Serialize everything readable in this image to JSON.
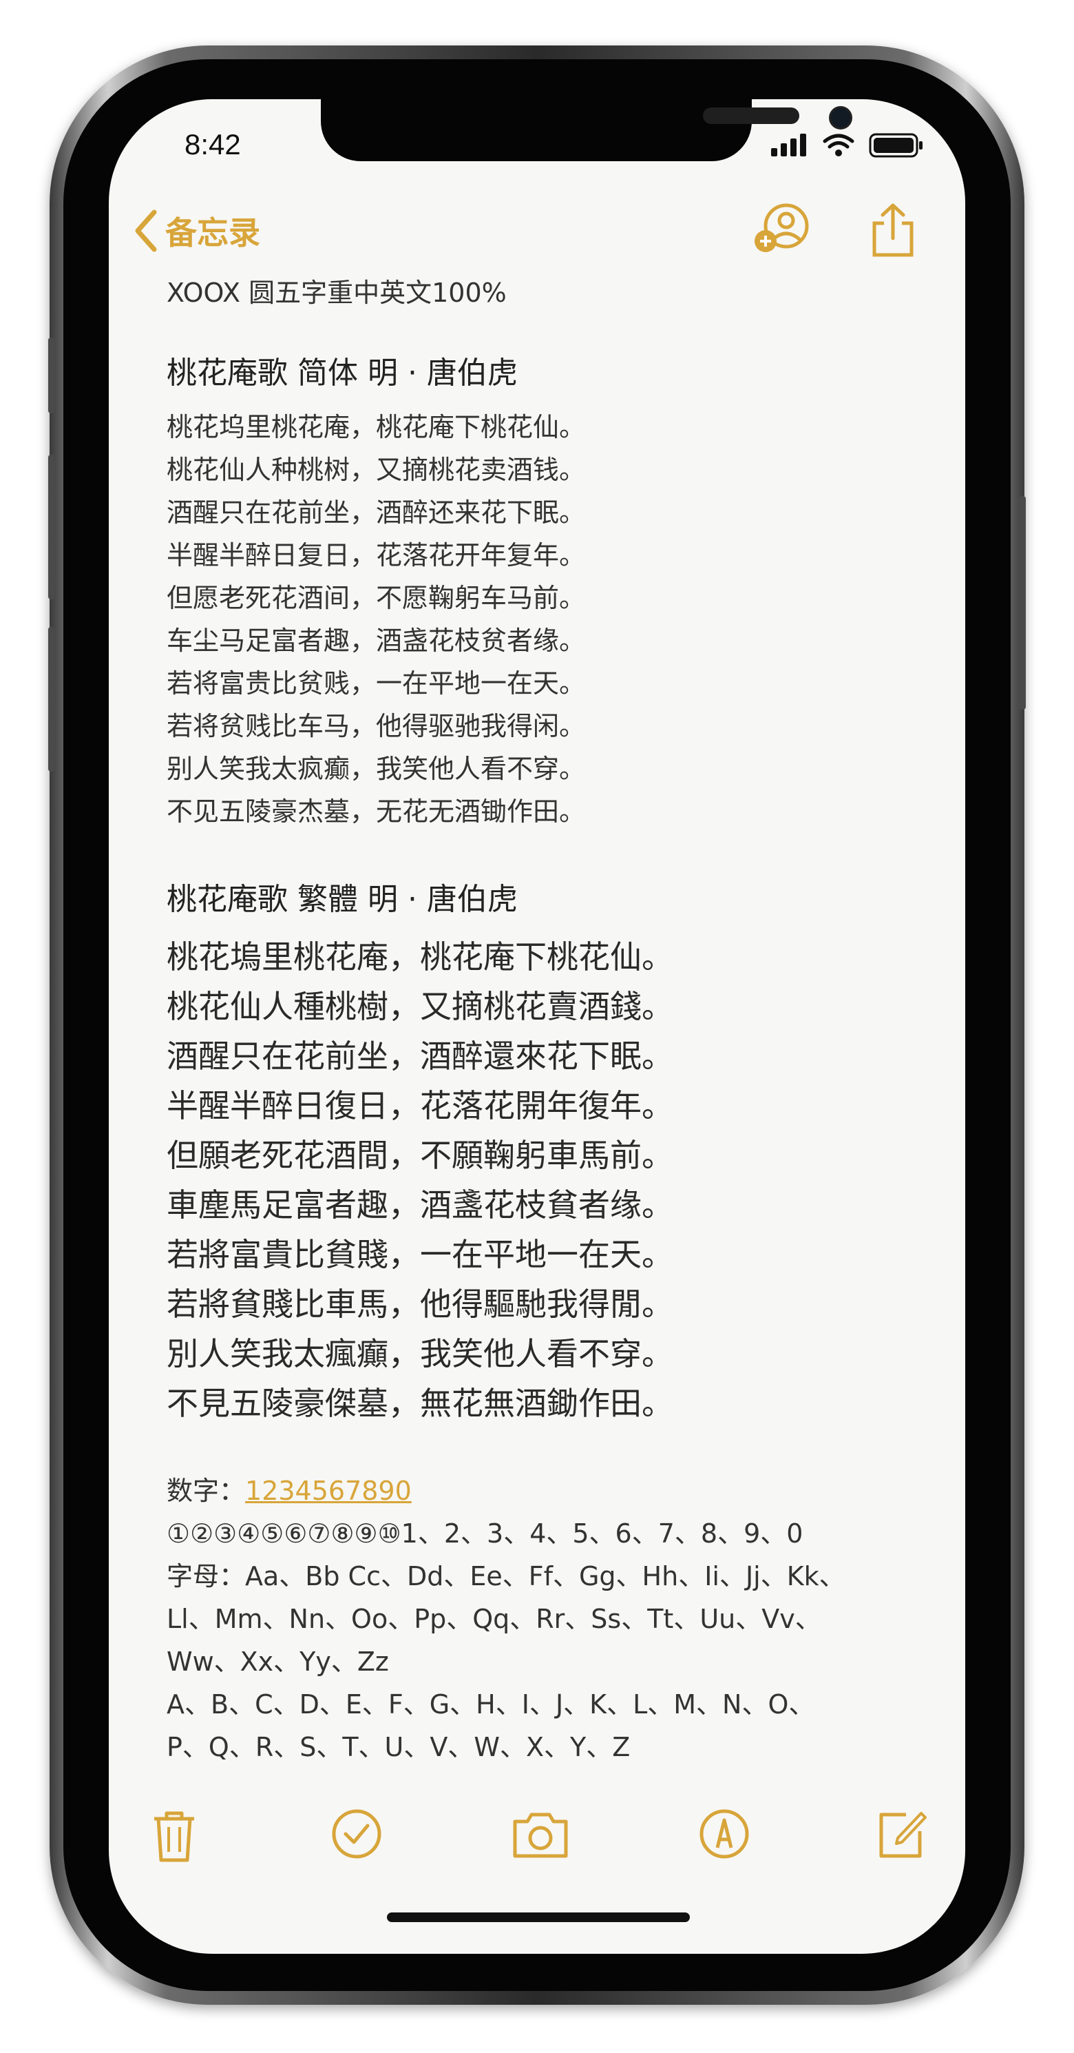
{
  "status": {
    "time": "8:42"
  },
  "nav": {
    "back_label": "备忘录"
  },
  "note": {
    "header": "XOOX 圆五字重中英文100%",
    "simplified": {
      "title": "桃花庵歌  简体    明 · 唐伯虎",
      "lines": [
        "桃花坞里桃花庵，桃花庵下桃花仙。",
        "桃花仙人种桃树，又摘桃花卖酒钱。",
        "酒醒只在花前坐，酒醉还来花下眠。",
        "半醒半醉日复日，花落花开年复年。",
        "但愿老死花酒间，不愿鞠躬车马前。",
        "车尘马足富者趣，酒盏花枝贫者缘。",
        "若将富贵比贫贱，一在平地一在天。",
        "若将贫贱比车马，他得驱驰我得闲。",
        "别人笑我太疯癫，我笑他人看不穿。",
        "不见五陵豪杰墓，无花无酒锄作田。"
      ]
    },
    "traditional": {
      "title": "桃花庵歌  繁體      明 · 唐伯虎",
      "lines": [
        "桃花塢里桃花庵，桃花庵下桃花仙。",
        "桃花仙人種桃樹，又摘桃花賣酒錢。",
        "酒醒只在花前坐，酒醉還來花下眠。",
        "半醒半醉日復日，花落花開年復年。",
        "但願老死花酒間，不願鞠躬車馬前。",
        "車塵馬足富者趣，酒盞花枝貧者缘。",
        "若將富貴比貧賤，一在平地一在天。",
        "若將貧賤比車馬，他得驅馳我得閒。",
        "別人笑我太瘋癲，我笑他人看不穿。",
        "不見五陵豪傑墓，無花無酒鋤作田。"
      ]
    },
    "digits_label": "数字：",
    "digits_value": "1234567890",
    "circled": "①②③④⑤⑥⑦⑧⑨⑩1、2、3、4、5、6、7、8、9、0",
    "letters": [
      "字母：Aa、Bb Cc、Dd、Ee、Ff、Gg、Hh、Ii、Jj、Kk、",
      "Ll、Mm、Nn、Oo、Pp、Qq、Rr、Ss、Tt、Uu、Vv、",
      "Ww、Xx、Yy、Zz",
      "A、B、C、D、E、F、G、H、I、J、K、L、M、N、O、",
      "P、Q、R、S、T、U、V、W、X、Y、Z"
    ]
  },
  "colors": {
    "accent": "#d8a53a",
    "paper": "#f7f7f5"
  }
}
